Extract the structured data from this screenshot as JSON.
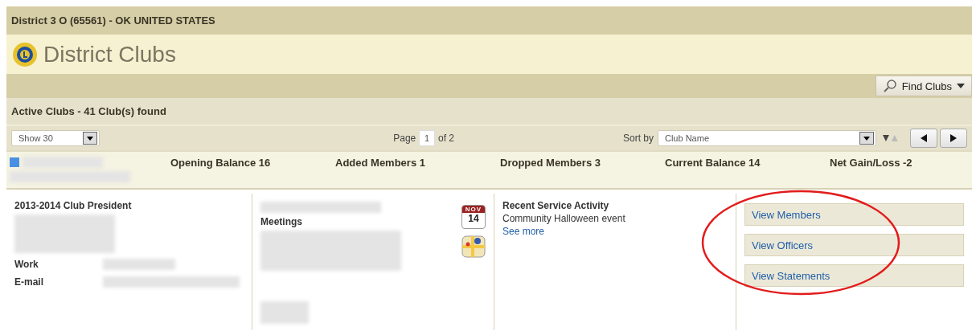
{
  "district_bar": {
    "title": "District 3 O (65561) - OK UNITED STATES"
  },
  "header": {
    "title": "District Clubs"
  },
  "toolbar": {
    "find_button": "Find Clubs"
  },
  "results": {
    "title": "Active Clubs - 41 Club(s) found"
  },
  "pager": {
    "show": "Show 30",
    "page_label": "Page",
    "page": "1",
    "page_of": "of 2",
    "sort_label": "Sort by",
    "sort": "Club Name"
  },
  "summary": {
    "stats": [
      "Opening Balance 16",
      "Added Members 1",
      "Dropped Members 3",
      "Current Balance 14",
      "Net Gain/Loss -2"
    ]
  },
  "club": {
    "president_heading": "2013-2014 Club President",
    "labels": [
      "Work",
      "E-mail"
    ],
    "meetings_heading": "Meetings",
    "calendar": {
      "month": "NOV",
      "day": "14"
    },
    "activity_heading": "Recent Service Activity",
    "activity": "Community Halloween event",
    "see_more": "See more",
    "actions": [
      "View Members",
      "View Officers",
      "View Statements"
    ]
  }
}
